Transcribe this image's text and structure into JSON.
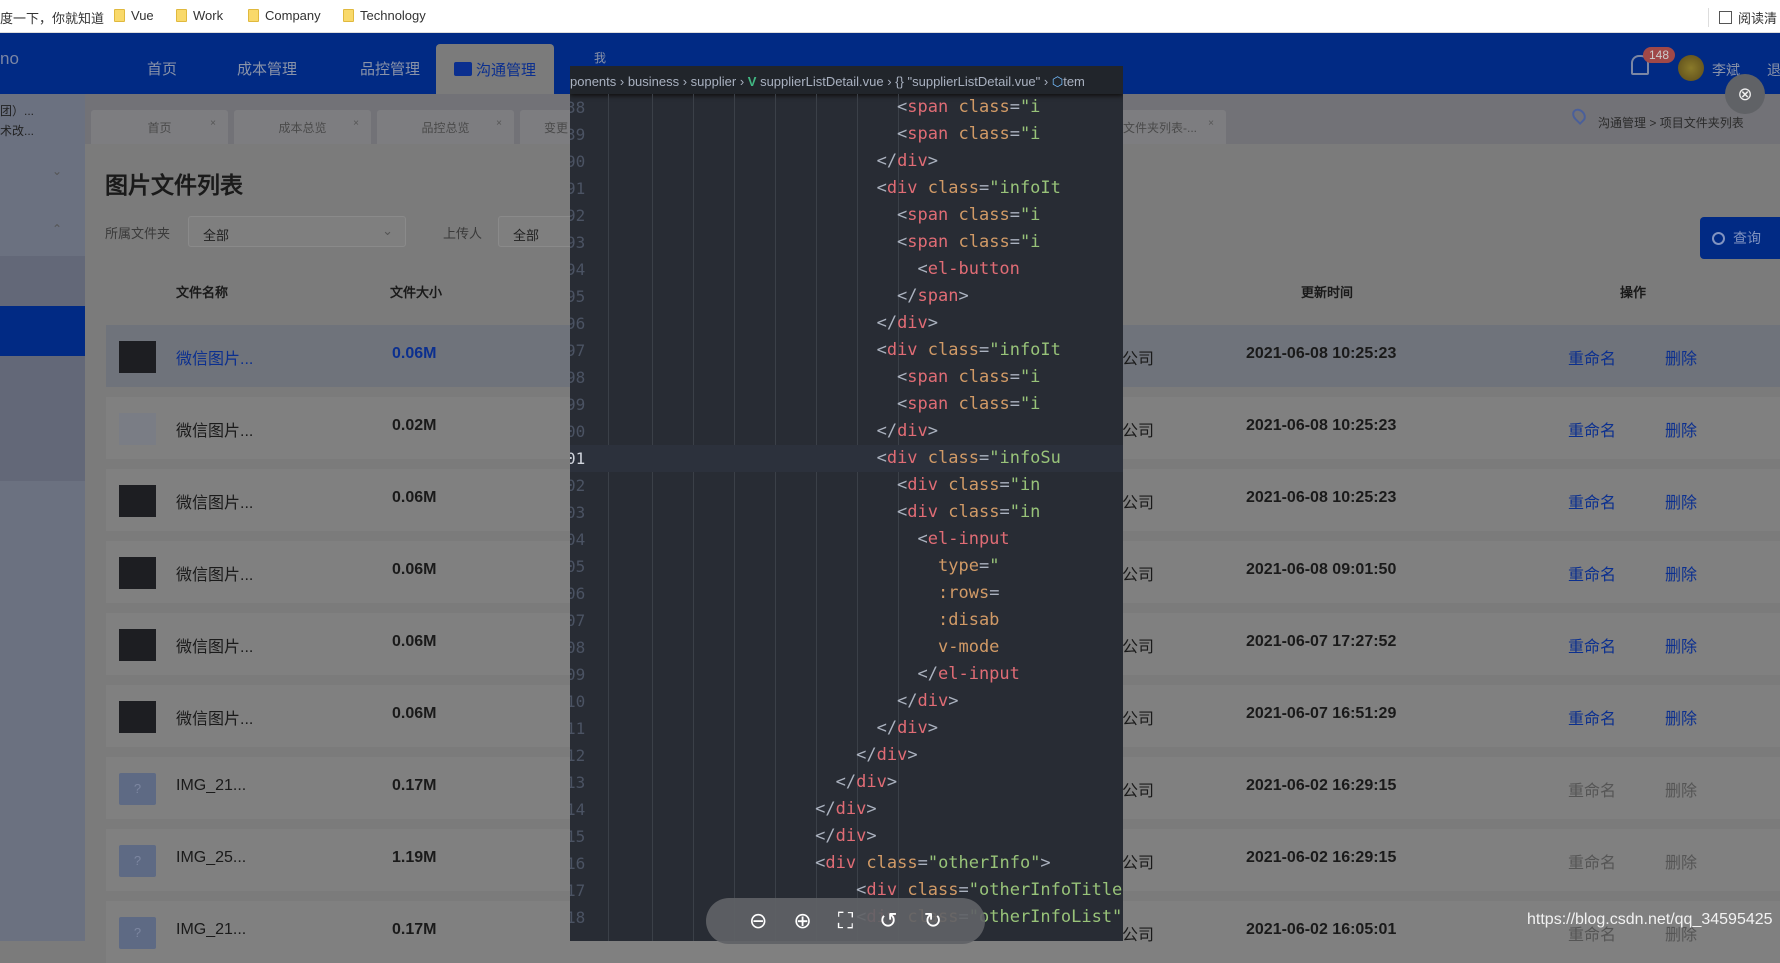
{
  "bookmarks": {
    "first": "度一下，你就知道",
    "folders": [
      "Vue",
      "Work",
      "Company",
      "Technology"
    ],
    "reading": "阅读清"
  },
  "header": {
    "logo_fragment": "no",
    "nav": [
      "首页",
      "成本管理",
      "品控管理"
    ],
    "active_nav": "沟通管理",
    "hidden_nav": "我",
    "badge": "148",
    "user": "李斌",
    "logout": "退"
  },
  "sidebar": {
    "lines": [
      "团）...",
      "术改..."
    ]
  },
  "page_tabs": [
    "首页",
    "成本总览",
    "品控总览",
    "变更",
    "文件夹列表-..."
  ],
  "breadcrumb": {
    "parent": "沟通管理",
    "sep": ">",
    "current": "项目文件夹列表"
  },
  "title": "图片文件列表",
  "filters": {
    "folder_label": "所属文件夹",
    "folder_value": "全部",
    "uploader_label": "上传人",
    "uploader_value": "全部",
    "query": "查询"
  },
  "table": {
    "headers": {
      "name": "文件名称",
      "size": "文件大小",
      "time": "更新时间",
      "ops": "操作"
    },
    "rename": "重命名",
    "delete": "删除",
    "rows": [
      {
        "thumb": "dark",
        "name": "微信图片...",
        "size": "0.06M",
        "company": "公司",
        "time": "2021-06-08 10:25:23",
        "enabled": true,
        "hover": true
      },
      {
        "thumb": "light",
        "name": "微信图片...",
        "size": "0.02M",
        "company": "公司",
        "time": "2021-06-08 10:25:23",
        "enabled": true
      },
      {
        "thumb": "dark",
        "name": "微信图片...",
        "size": "0.06M",
        "company": "公司",
        "time": "2021-06-08 10:25:23",
        "enabled": true
      },
      {
        "thumb": "dark",
        "name": "微信图片...",
        "size": "0.06M",
        "company": "公司",
        "time": "2021-06-08 09:01:50",
        "enabled": true
      },
      {
        "thumb": "dark",
        "name": "微信图片...",
        "size": "0.06M",
        "company": "公司",
        "time": "2021-06-07 17:27:52",
        "enabled": true
      },
      {
        "thumb": "dark",
        "name": "微信图片...",
        "size": "0.06M",
        "company": "公司",
        "time": "2021-06-07 16:51:29",
        "enabled": true
      },
      {
        "thumb": "unknown",
        "name": "IMG_21...",
        "size": "0.17M",
        "company": "公司",
        "time": "2021-06-02 16:29:15",
        "enabled": false
      },
      {
        "thumb": "unknown",
        "name": "IMG_25...",
        "size": "1.19M",
        "company": "公司",
        "time": "2021-06-02 16:29:15",
        "enabled": false
      },
      {
        "thumb": "unknown",
        "name": "IMG_21...",
        "size": "0.17M",
        "company": "公司",
        "time": "2021-06-02 16:05:01",
        "enabled": false
      }
    ]
  },
  "viewer": {
    "breadcrumb": "ponents › business › supplier › ",
    "file": "supplierListDetail.vue",
    "symbol": " › {} \"supplierListDetail.vue\" › ",
    "tail": "tem",
    "current_line": "01",
    "lines": [
      {
        "n": "38",
        "t": "        <span class=\"i"
      },
      {
        "n": "39",
        "t": "        <span class=\"i"
      },
      {
        "n": "90",
        "t": "      </div>"
      },
      {
        "n": "91",
        "t": "      <div class=\"infoIt"
      },
      {
        "n": "92",
        "t": "        <span class=\"i"
      },
      {
        "n": "93",
        "t": "        <span class=\"i"
      },
      {
        "n": "94",
        "t": "          <el-button"
      },
      {
        "n": "95",
        "t": "        </span>"
      },
      {
        "n": "96",
        "t": "      </div>"
      },
      {
        "n": "97",
        "t": "      <div class=\"infoIt"
      },
      {
        "n": "98",
        "t": "        <span class=\"i"
      },
      {
        "n": "99",
        "t": "        <span class=\"i"
      },
      {
        "n": "00",
        "t": "      </div>"
      },
      {
        "n": "01",
        "t": "      <div class=\"infoSu"
      },
      {
        "n": "02",
        "t": "        <div class=\"in"
      },
      {
        "n": "03",
        "t": "        <div class=\"in"
      },
      {
        "n": "04",
        "t": "          <el-input"
      },
      {
        "n": "05",
        "t": "            type=\""
      },
      {
        "n": "06",
        "t": "            :rows="
      },
      {
        "n": "07",
        "t": "            :disab"
      },
      {
        "n": "08",
        "t": "            v-mode"
      },
      {
        "n": "09",
        "t": "          </el-input"
      },
      {
        "n": "10",
        "t": "        </div>"
      },
      {
        "n": "11",
        "t": "      </div>"
      },
      {
        "n": "12",
        "t": "    </div>"
      },
      {
        "n": "13",
        "t": "  </div>"
      },
      {
        "n": "14",
        "t": "</div>"
      },
      {
        "n": "15",
        "t": "</div>"
      },
      {
        "n": "16",
        "t": "<div class=\"otherInfo\">"
      },
      {
        "n": "17",
        "t": "    <div class=\"otherInfoTitle\">其他"
      },
      {
        "n": "18",
        "t": "    <div class=\"otherInfoList\" v-if"
      }
    ],
    "tools": [
      "zoom-out-icon",
      "zoom-in-icon",
      "fit-screen-icon",
      "rotate-left-icon",
      "rotate-right-icon"
    ]
  },
  "watermark": "https://blog.csdn.net/qq_34595425",
  "colors": {
    "brand": "#012a84",
    "code_bg": "#282c34",
    "tag": "#e06c75",
    "attr": "#d19a66",
    "string": "#98c379"
  }
}
